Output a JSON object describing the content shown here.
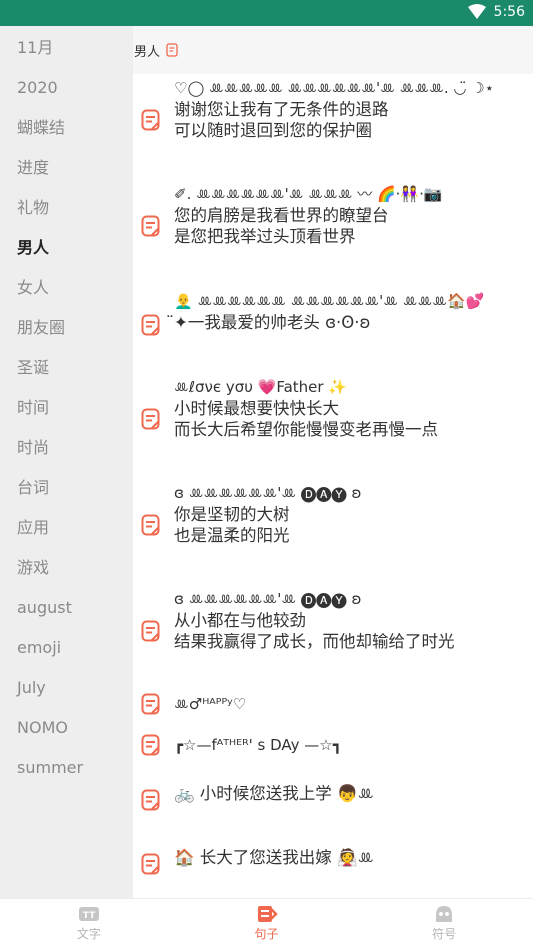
{
  "status_bar": {
    "time": "5:56"
  },
  "sidebar": {
    "items": [
      {
        "label": "11月"
      },
      {
        "label": "2020"
      },
      {
        "label": "蝴蝶结"
      },
      {
        "label": "进度"
      },
      {
        "label": "礼物"
      },
      {
        "label": "男人",
        "active": true
      },
      {
        "label": "女人"
      },
      {
        "label": "朋友圈"
      },
      {
        "label": "圣诞"
      },
      {
        "label": "时间"
      },
      {
        "label": "时尚"
      },
      {
        "label": "台词"
      },
      {
        "label": "应用"
      },
      {
        "label": "游戏"
      },
      {
        "label": "august"
      },
      {
        "label": "emoji"
      },
      {
        "label": "July"
      },
      {
        "label": "NOMO"
      },
      {
        "label": "summer"
      }
    ]
  },
  "header": {
    "category": "男人"
  },
  "sentences": [
    {
      "lines": [
        "♡◯ ꔛꔛꔛꔛꔛ ꔛꔛꔛꔛꔛꔛ'ꔛ ꔛꔛꔛ. ◡̈ ☽⋆",
        "谢谢您让我有了无条件的退路",
        "可以随时退回到您的保护圈"
      ]
    },
    {
      "lines": [
        "✐. ꔛꔛꔛꔛꔛꔛ'ꔛ ꔛꔛꔛ 〰 🌈·👭·📷",
        "您的肩膀是我看世界的瞭望台",
        "是您把我举过头顶看世界"
      ]
    },
    {
      "lines": [
        "👨‍🦲 ꔛꔛꔛꔛꔛꔛ ꔛꔛꔛꔛꔛꔛ'ꔛ ꔛꔛꔛ🏠💕",
        "̈✦一我最爱的帅老头 ɞ·ʘ·ʚ"
      ]
    },
    {
      "lines": [
        "ꔛℓσνє уσυ 💗Father ✨",
        "小时候最想要快快长大",
        "而长大后希望你能慢慢变老再慢一点"
      ]
    },
    {
      "lines": [
        "ɞ ꔛꔛꔛꔛꔛꔛ'ꔛ 🅓🅐🅨 ʚ",
        "你是坚韧的大树",
        "也是温柔的阳光"
      ]
    },
    {
      "lines": [
        "ɞ ꔛꔛꔛꔛꔛꔛ'ꔛ 🅓🅐🅨 ʚ",
        "从小都在与他较劲",
        "结果我赢得了成长，而他却输给了时光"
      ]
    },
    {
      "lines": [
        "ꔛ♂ᴴᴬᴾᴾʸ♡"
      ]
    },
    {
      "lines": [
        "┏☆—fᴬᵀᴴᴱᴿ' s DAy —☆┓"
      ]
    },
    {
      "lines": [
        "🚲 小时候您送我上学 👦ꔛ"
      ]
    },
    {
      "lines": [
        "🏠 长大了您送我出嫁 👰ꔛ"
      ]
    }
  ],
  "bottom_nav": [
    {
      "label": "文字",
      "icon": "text-icon"
    },
    {
      "label": "句子",
      "icon": "sentence-icon",
      "active": true
    },
    {
      "label": "符号",
      "icon": "symbol-icon"
    }
  ],
  "colors": {
    "status_bar": "#1a8a6a",
    "accent": "#f0684e",
    "sidebar_bg": "#eeeeee"
  }
}
